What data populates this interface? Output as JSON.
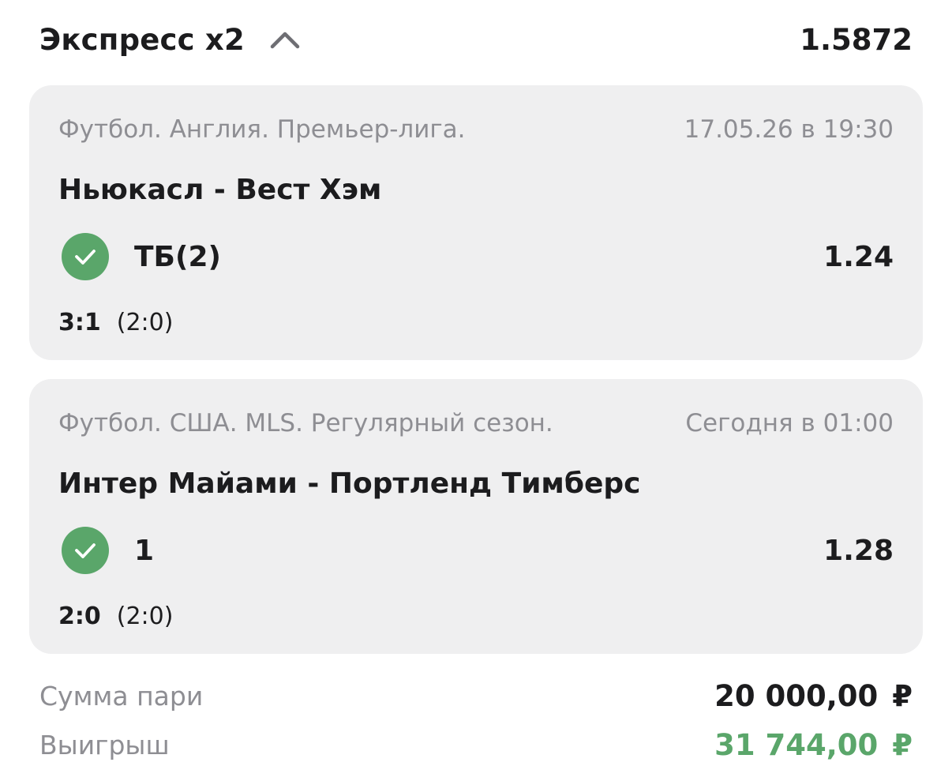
{
  "header": {
    "title": "Экспресс x2",
    "total_odds": "1.5872",
    "toggle_icon": "chevron-up-icon"
  },
  "bets": [
    {
      "league": "Футбол. Англия. Премьер-лига.",
      "date": "17.05.26 в 19:30",
      "teams": "Ньюкасл - Вест Хэм",
      "bet": "ТБ(2)",
      "odds": "1.24",
      "score": "3:1",
      "halftime": "(2:0)",
      "status_icon": "check-circle-icon"
    },
    {
      "league": "Футбол. США. MLS. Регулярный сезон.",
      "date": "Сегодня в 01:00",
      "teams": "Интер Майами - Портленд Тимберс",
      "bet": "1",
      "odds": "1.28",
      "score": "2:0",
      "halftime": "(2:0)",
      "status_icon": "check-circle-icon"
    }
  ],
  "summary": {
    "stake_label": "Сумма пари",
    "stake_value": "20 000,00",
    "win_label": "Выигрыш",
    "win_value": "31 744,00",
    "currency": "₽"
  },
  "colors": {
    "accent_green": "#5aa66a",
    "card_bg": "#efeff0",
    "muted_text": "#8e8e93",
    "primary_text": "#1c1c1e"
  }
}
